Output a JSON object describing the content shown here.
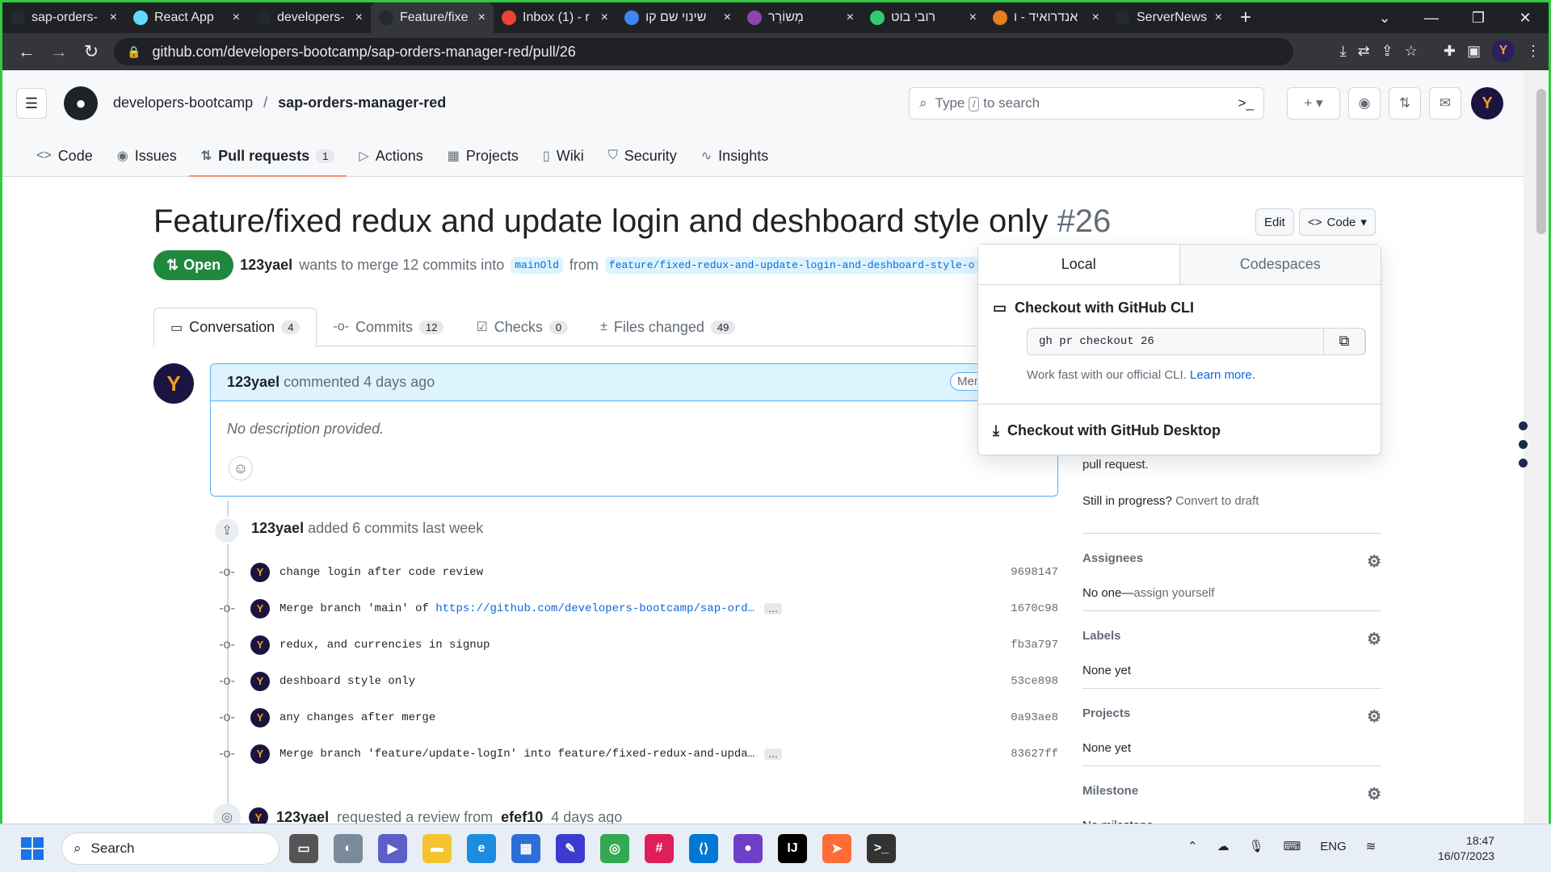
{
  "browser": {
    "tabs": [
      {
        "title": "sap-orders-",
        "fav_color": "#24292f"
      },
      {
        "title": "React App",
        "fav_color": "#61dafb"
      },
      {
        "title": "developers-",
        "fav_color": "#24292f"
      },
      {
        "title": "Feature/fixe",
        "fav_color": "#24292f"
      },
      {
        "title": "Inbox (1) - r",
        "fav_color": "#ea4335"
      },
      {
        "title": "שינוי שם קו",
        "fav_color": "#4285f4"
      },
      {
        "title": "מְשוֹרֵר",
        "fav_color": "#8e44ad"
      },
      {
        "title": "רובי בוט",
        "fav_color": "#2ecc71"
      },
      {
        "title": "אנדרואיד - ו",
        "fav_color": "#e67e22"
      },
      {
        "title": "ServerNews",
        "fav_color": "#24292f"
      }
    ],
    "url": "github.com/developers-bootcamp/sap-orders-manager-red/pull/26"
  },
  "github": {
    "owner": "developers-bootcamp",
    "repo": "sap-orders-manager-red",
    "search_placeholder_pre": "Type",
    "search_key": "/",
    "search_placeholder_post": "to search",
    "repo_tabs": [
      {
        "label": "Code",
        "icon": "code-icon"
      },
      {
        "label": "Issues",
        "icon": "issue-icon"
      },
      {
        "label": "Pull requests",
        "icon": "pull-request-icon",
        "count": "1"
      },
      {
        "label": "Actions",
        "icon": "play-icon"
      },
      {
        "label": "Projects",
        "icon": "table-icon"
      },
      {
        "label": "Wiki",
        "icon": "book-icon"
      },
      {
        "label": "Security",
        "icon": "shield-icon"
      },
      {
        "label": "Insights",
        "icon": "graph-icon"
      }
    ]
  },
  "pr": {
    "title": "Feature/fixed redux and update login and deshboard style only",
    "number": "#26",
    "edit_label": "Edit",
    "code_label": "Code",
    "status": "Open",
    "author": "123yael",
    "merge_text": "wants to merge 12 commits into",
    "base_branch": "mainOld",
    "from_text": "from",
    "head_branch": "feature/fixed-redux-and-update-login-and-deshboard-style-o",
    "tabs": [
      {
        "label": "Conversation",
        "count": "4"
      },
      {
        "label": "Commits",
        "count": "12"
      },
      {
        "label": "Checks",
        "count": "0"
      },
      {
        "label": "Files changed",
        "count": "49"
      }
    ]
  },
  "comment": {
    "author": "123yael",
    "action": "commented 4 days ago",
    "badge": "Mem",
    "body": "No description provided."
  },
  "timeline": {
    "event_author": "123yael",
    "event_text": "added 6 commits last week",
    "commits": [
      {
        "msg": "change login after code review",
        "link": "",
        "ellipsis": false,
        "sha": "9698147"
      },
      {
        "msg": "Merge branch 'main' of ",
        "link": "https://github.com/developers-bootcamp/sap-ord…",
        "ellipsis": true,
        "sha": "1670c98"
      },
      {
        "msg": "redux, and currencies in signup",
        "link": "",
        "ellipsis": false,
        "sha": "fb3a797"
      },
      {
        "msg": "deshboard style only",
        "link": "",
        "ellipsis": false,
        "sha": "53ce898"
      },
      {
        "msg": "any changes after merge",
        "link": "",
        "ellipsis": false,
        "sha": "0a93ae8"
      },
      {
        "msg": "Merge branch 'feature/update-logIn' into feature/fixed-redux-and-upda…",
        "link": "",
        "ellipsis": true,
        "sha": "83627ff"
      }
    ],
    "review_author": "123yael",
    "review_text": "requested a review from",
    "reviewer": "efef10",
    "review_time": "4 days ago"
  },
  "sidebar": {
    "pr_text": "pull request.",
    "progress_q": "Still in progress?",
    "draft_link": "Convert to draft",
    "sections": [
      {
        "title": "Assignees",
        "value": "No one—",
        "link": "assign yourself"
      },
      {
        "title": "Labels",
        "value": "None yet",
        "link": ""
      },
      {
        "title": "Projects",
        "value": "None yet",
        "link": ""
      },
      {
        "title": "Milestone",
        "value": "No milestone",
        "link": ""
      }
    ]
  },
  "dropdown": {
    "tab_local": "Local",
    "tab_codespaces": "Codespaces",
    "cli_title": "Checkout with GitHub CLI",
    "cli_cmd": "gh pr checkout 26",
    "cli_note": "Work fast with our official CLI.",
    "cli_learn": "Learn more.",
    "desktop_title": "Checkout with GitHub Desktop"
  },
  "taskbar": {
    "search": "Search",
    "lang": "ENG",
    "time": "18:47",
    "date": "16/07/2023"
  }
}
